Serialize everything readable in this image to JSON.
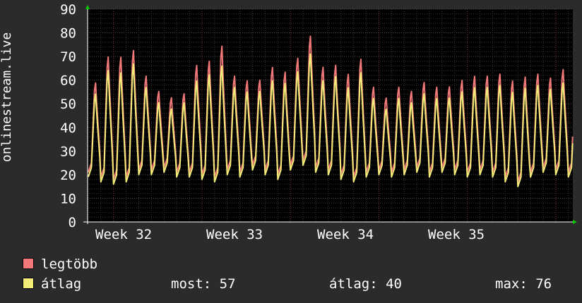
{
  "chart_data": {
    "type": "line",
    "ylabel": "onlinestream.live",
    "ylim": [
      0,
      90
    ],
    "yticks": [
      "0",
      "10",
      "20",
      "30",
      "40",
      "50",
      "60",
      "70",
      "80",
      "90"
    ],
    "xticks": [
      "Week 32",
      "Week 33",
      "Week 34",
      "Week 35"
    ],
    "series": [
      {
        "name": "legtöbb",
        "color": "#f07878",
        "daily_peaks": [
          62,
          74,
          74,
          77,
          65,
          58,
          55,
          57,
          70,
          72,
          79,
          65,
          63,
          63,
          69,
          67,
          73,
          83,
          69,
          70,
          66,
          73,
          60,
          55,
          60,
          58,
          62,
          60,
          60,
          63,
          65,
          65,
          66,
          63,
          65,
          66,
          64,
          68,
          65
        ]
      },
      {
        "name": "átlag",
        "color": "#f4ec78",
        "daily_peaks": [
          57,
          68,
          67,
          71,
          60,
          53,
          50,
          53,
          63,
          66,
          70,
          60,
          58,
          58,
          63,
          62,
          67,
          75,
          63,
          65,
          60,
          67,
          55,
          50,
          55,
          53,
          57,
          55,
          55,
          58,
          60,
          60,
          61,
          58,
          60,
          61,
          59,
          62,
          60
        ]
      }
    ]
  },
  "legend": {
    "max_label": "legtöbb",
    "avg_label": "átlag",
    "max_color": "#f07878",
    "avg_color": "#f4ec78"
  },
  "stats": {
    "now": "most: 57",
    "avg": "átlag: 40",
    "max": "max: 76"
  }
}
